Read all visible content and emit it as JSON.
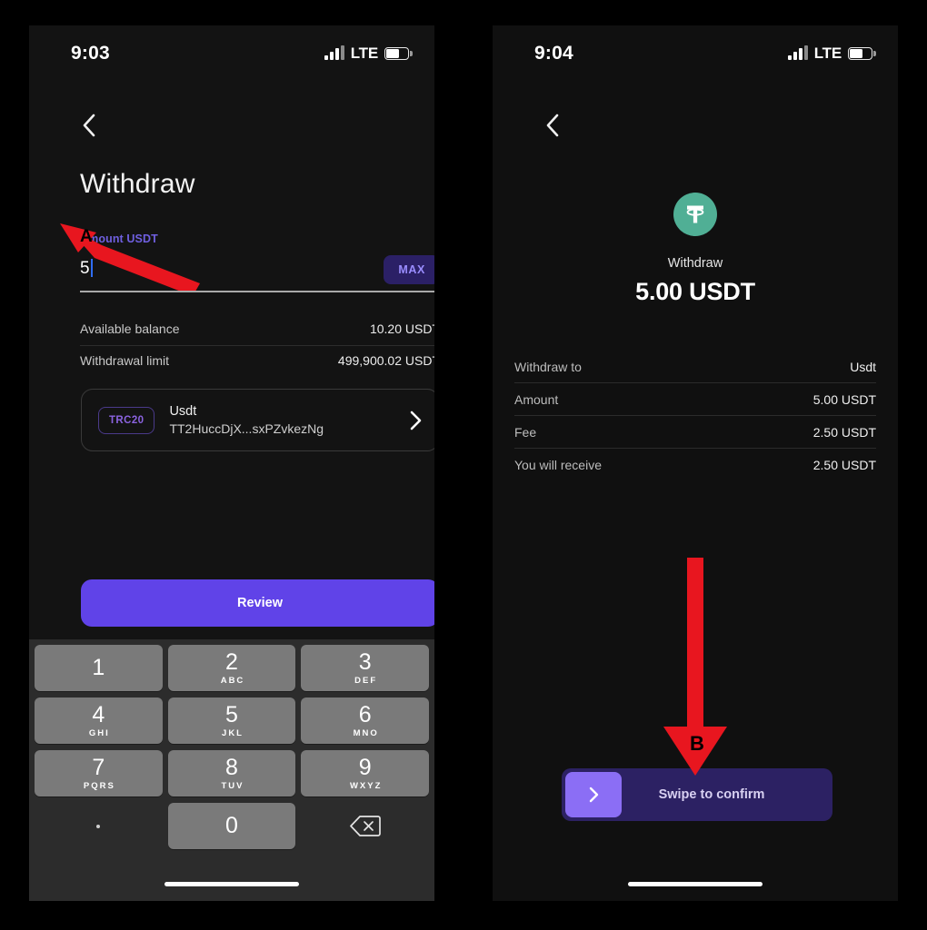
{
  "left_phone": {
    "status_bar": {
      "time": "9:03",
      "network_label": "LTE",
      "signal_icon": "signal-bars-icon",
      "battery_icon": "battery-icon",
      "battery_fill_percent": 62
    },
    "back_icon": "chevron-left-icon",
    "title": "Withdraw",
    "amount_field": {
      "label": "Amount USDT",
      "label_color": "#6f5fe0",
      "value": "5",
      "max_button": "MAX"
    },
    "info_rows": [
      {
        "key": "Available balance",
        "value": "10.20 USDT"
      },
      {
        "key": "Withdrawal limit",
        "value": "499,900.02 USDT"
      }
    ],
    "address_card": {
      "network_badge": "TRC20",
      "name": "Usdt",
      "address": "TT2HuccDjX...sxPZvkezNg",
      "chevron_icon": "chevron-right-icon"
    },
    "primary_button": "Review",
    "keypad": {
      "rows": [
        [
          {
            "digit": "1",
            "letters": ""
          },
          {
            "digit": "2",
            "letters": "ABC"
          },
          {
            "digit": "3",
            "letters": "DEF"
          }
        ],
        [
          {
            "digit": "4",
            "letters": "GHI"
          },
          {
            "digit": "5",
            "letters": "JKL"
          },
          {
            "digit": "6",
            "letters": "MNO"
          }
        ],
        [
          {
            "digit": "7",
            "letters": "PQRS"
          },
          {
            "digit": "8",
            "letters": "TUV"
          },
          {
            "digit": "9",
            "letters": "WXYZ"
          }
        ]
      ],
      "decimal_key": ".",
      "zero_key": "0",
      "delete_icon": "backspace-icon"
    }
  },
  "right_phone": {
    "status_bar": {
      "time": "9:04",
      "network_label": "LTE",
      "signal_icon": "signal-bars-icon",
      "battery_icon": "battery-icon",
      "battery_fill_percent": 62
    },
    "back_icon": "chevron-left-icon",
    "coin_icon": "tether-usdt-icon",
    "coin_color": "#50af95",
    "action_label": "Withdraw",
    "amount_headline": "5.00 USDT",
    "summary_rows": [
      {
        "key": "Withdraw to",
        "value": "Usdt"
      },
      {
        "key": "Amount",
        "value": "5.00 USDT"
      },
      {
        "key": "Fee",
        "value": "2.50 USDT"
      },
      {
        "key": "You will receive",
        "value": "2.50 USDT"
      }
    ],
    "swipe": {
      "label": "Swipe to confirm",
      "handle_icon": "chevron-right-icon",
      "track_color": "#2c2163",
      "handle_color": "#8b6ef5"
    }
  },
  "annotations": {
    "color": "#e8161f",
    "markers": [
      {
        "id": "A",
        "label": "A",
        "shape": "diagonal-arrow",
        "points_to": "amount-input"
      },
      {
        "id": "B",
        "label": "B",
        "shape": "down-arrow",
        "points_to": "swipe-to-confirm"
      }
    ]
  }
}
